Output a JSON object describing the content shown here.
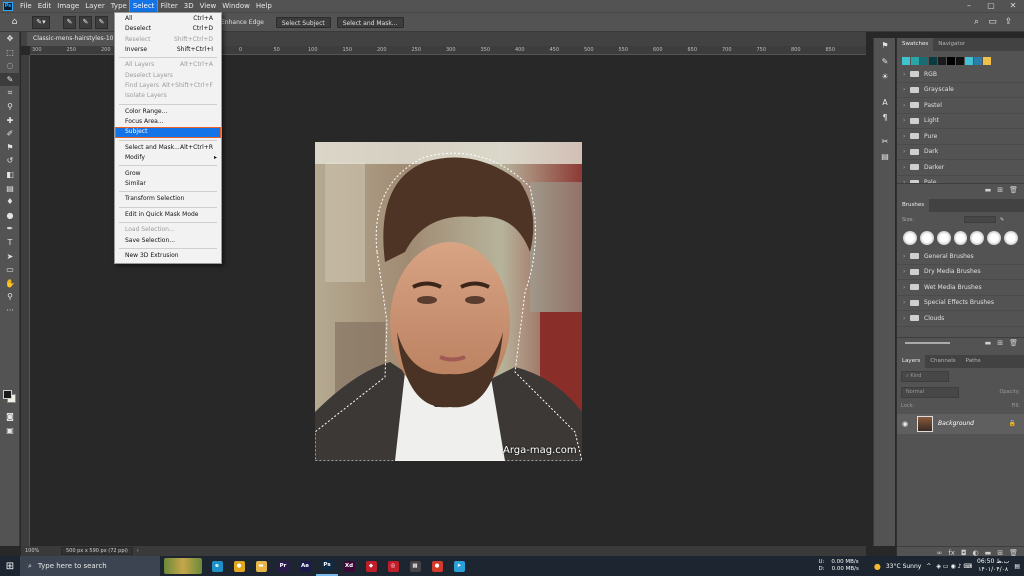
{
  "menubar": {
    "logo": "Ps",
    "items": [
      "File",
      "Edit",
      "Image",
      "Layer",
      "Type",
      "Select",
      "Filter",
      "3D",
      "View",
      "Window",
      "Help"
    ],
    "open_item": "Select"
  },
  "options_bar": {
    "enhance_edge": "Enhance Edge",
    "select_subject": "Select Subject",
    "select_and_mask": "Select and Mask..."
  },
  "document": {
    "tab_title": "Classic-mens-hairstyles-10.jpg",
    "ruler_ticks": [
      "300",
      "250",
      "200",
      "150",
      "100",
      "50",
      "0",
      "50",
      "100",
      "150",
      "200",
      "250",
      "300",
      "350",
      "400",
      "450",
      "500",
      "550",
      "600",
      "650",
      "700",
      "750",
      "800",
      "850"
    ],
    "zoom": "100%",
    "doc_size": "500 px x 590 px (72 ppi)",
    "watermark": "Arga-mag.com"
  },
  "select_menu": {
    "items": [
      {
        "label": "All",
        "shortcut": "Ctrl+A",
        "disabled": false
      },
      {
        "label": "Deselect",
        "shortcut": "Ctrl+D",
        "disabled": false
      },
      {
        "label": "Reselect",
        "shortcut": "Shift+Ctrl+D",
        "disabled": true
      },
      {
        "label": "Inverse",
        "shortcut": "Shift+Ctrl+I",
        "disabled": false
      },
      {
        "sep": true
      },
      {
        "label": "All Layers",
        "shortcut": "Alt+Ctrl+A",
        "disabled": true
      },
      {
        "label": "Deselect Layers",
        "shortcut": "",
        "disabled": true
      },
      {
        "label": "Find Layers",
        "shortcut": "Alt+Shift+Ctrl+F",
        "disabled": true
      },
      {
        "label": "Isolate Layers",
        "shortcut": "",
        "disabled": true
      },
      {
        "sep": true
      },
      {
        "label": "Color Range...",
        "shortcut": "",
        "disabled": false
      },
      {
        "label": "Focus Area...",
        "shortcut": "",
        "disabled": false
      },
      {
        "label": "Subject",
        "shortcut": "",
        "disabled": false,
        "highlighted": true
      },
      {
        "sep": true
      },
      {
        "label": "Select and Mask...",
        "shortcut": "Alt+Ctrl+R",
        "disabled": false
      },
      {
        "label": "Modify",
        "shortcut": "",
        "disabled": false,
        "submenu": true
      },
      {
        "sep": true
      },
      {
        "label": "Grow",
        "shortcut": "",
        "disabled": false
      },
      {
        "label": "Similar",
        "shortcut": "",
        "disabled": false
      },
      {
        "sep": true
      },
      {
        "label": "Transform Selection",
        "shortcut": "",
        "disabled": false
      },
      {
        "sep": true
      },
      {
        "label": "Edit in Quick Mask Mode",
        "shortcut": "",
        "disabled": false
      },
      {
        "sep": true
      },
      {
        "label": "Load Selection...",
        "shortcut": "",
        "disabled": true
      },
      {
        "label": "Save Selection...",
        "shortcut": "",
        "disabled": false
      },
      {
        "sep": true
      },
      {
        "label": "New 3D Extrusion",
        "shortcut": "",
        "disabled": false
      }
    ]
  },
  "swatches_panel": {
    "tabs": [
      "Swatches",
      "Navigator"
    ],
    "colors": [
      "#3fc3cf",
      "#2aa6a8",
      "#1b6b70",
      "#0a3b40",
      "#1b1b1b",
      "#000000",
      "#111111",
      "#45c1d6",
      "#2c7ea7",
      "#f0c04a"
    ],
    "folders": [
      "RGB",
      "Grayscale",
      "Pastel",
      "Light",
      "Pure",
      "Dark",
      "Darker",
      "Pale"
    ]
  },
  "brushes_panel": {
    "tab": "Brushes",
    "size_label": "Size:",
    "folders": [
      "General Brushes",
      "Dry Media Brushes",
      "Wet Media Brushes",
      "Special Effects Brushes",
      "Clouds"
    ]
  },
  "layers_panel": {
    "tabs": [
      "Layers",
      "Channels",
      "Paths"
    ],
    "kind": "Kind",
    "blend": "Normal",
    "opacity_label": "Opacity:",
    "lock_label": "Lock:",
    "fill_label": "Fill:",
    "layer_name": "Background"
  },
  "taskbar": {
    "search_placeholder": "Type here to search",
    "apps": [
      {
        "name": "edge",
        "color": "#1e90c8",
        "label": "e"
      },
      {
        "name": "chrome",
        "color": "#e0a81e",
        "label": "●"
      },
      {
        "name": "explorer",
        "color": "#e9b64a",
        "label": "▬"
      },
      {
        "name": "premiere",
        "color": "#2a1a4a",
        "label": "Pr"
      },
      {
        "name": "after-effects",
        "color": "#1a1a4a",
        "label": "Ae"
      },
      {
        "name": "photoshop",
        "color": "#0c2a44",
        "label": "Ps"
      },
      {
        "name": "xd",
        "color": "#3a0a36",
        "label": "Xd"
      },
      {
        "name": "shield-app",
        "color": "#c21e2a",
        "label": "◆"
      },
      {
        "name": "red-app",
        "color": "#c21e2a",
        "label": "◎"
      },
      {
        "name": "calculator",
        "color": "#444444",
        "label": "▦"
      },
      {
        "name": "record-app",
        "color": "#d33a2a",
        "label": "●"
      },
      {
        "name": "telegram",
        "color": "#2a9fd8",
        "label": "➤"
      }
    ],
    "net_up_label": "U:",
    "net_up": "0.00 MB/s",
    "net_down_label": "D:",
    "net_down": "0.00 MB/s",
    "weather": "33°C  Sunny",
    "time": "06:50 ب.ظ",
    "date": "۱۴۰۱/۰۴/۰۸"
  }
}
